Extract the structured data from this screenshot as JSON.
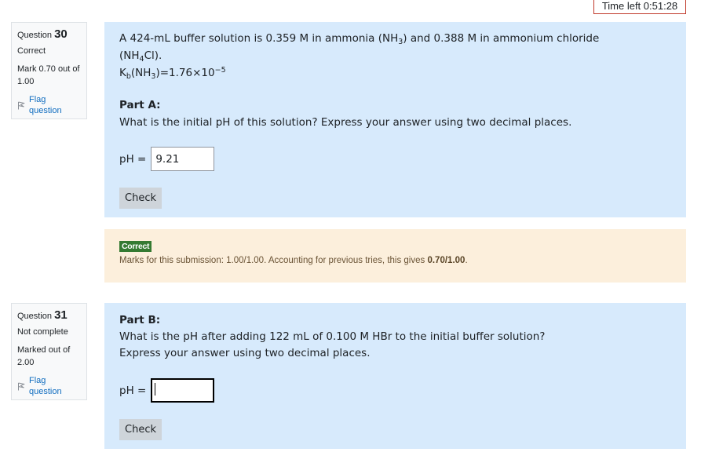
{
  "timer": {
    "label": "Time left 0:51:28"
  },
  "questions": [
    {
      "number_prefix": "Question",
      "number": "30",
      "state": "Correct",
      "grade_line1": "Mark 0.70 out of",
      "grade_line2": "1.00",
      "flag_label": "Flag question",
      "flag_icon": "flag-icon"
    },
    {
      "number_prefix": "Question",
      "number": "31",
      "state": "Not complete",
      "grade_line1": "Marked out of",
      "grade_line2": "2.00",
      "flag_label": "Flag question",
      "flag_icon": "flag-icon"
    }
  ],
  "q30": {
    "intro_line1": "A 424-mL buffer solution is 0.359 M in ammonia (NH",
    "intro_sub1": "3",
    "intro_line1_end": ") and 0.388 M in ammonium chloride",
    "intro_line2_a": "(NH",
    "intro_sub2": "4",
    "intro_line2_b": "Cl).",
    "kb_a": "K",
    "kb_sub": "b",
    "kb_b": "(NH",
    "kb_sub2": "3",
    "kb_c": ")=1.76×10",
    "kb_sup": "−5",
    "part_label": "Part A:",
    "prompt": "What is the initial pH of this solution? Express your answer using two decimal places.",
    "answer_label": "pH =",
    "answer_value": "9.21",
    "check_label": "Check"
  },
  "feedback": {
    "badge": "Correct",
    "text": "Marks for this submission: 1.00/1.00. Accounting for previous tries, this gives ",
    "score": "0.70/1.00",
    "text_end": ".",
    "badge_color": "#357a32"
  },
  "q31": {
    "part_label": "Part B:",
    "prompt_line1": "What is the pH after adding 122 mL of 0.100 M HBr to the initial buffer solution?",
    "prompt_line2": "Express your answer using two decimal places.",
    "answer_label": "pH =",
    "answer_value": "",
    "check_label": "Check"
  },
  "colors": {
    "formulation_bg": "#d7eafc",
    "feedback_bg": "#fcefdc",
    "link": "#0f6cbf",
    "timer_border": "#c0392b"
  }
}
